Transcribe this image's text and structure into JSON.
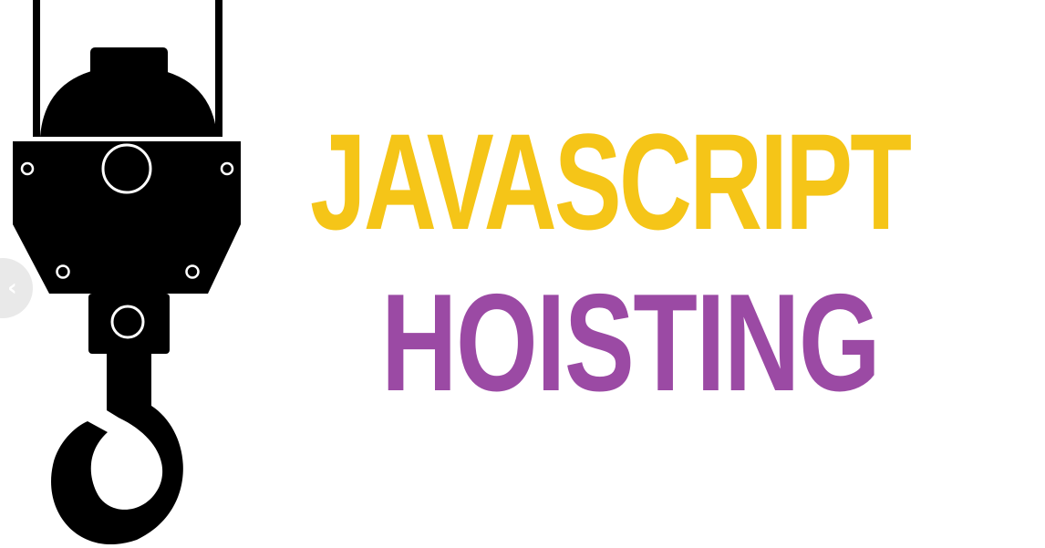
{
  "banner": {
    "title_line1": "JAVASCRIPT",
    "title_line2": "HOISTING"
  },
  "colors": {
    "line1": "#f5c518",
    "line2": "#9b4aa4",
    "hook": "#000000",
    "background": "#ffffff",
    "nav_button": "#e9e9e9"
  },
  "icons": {
    "hook": "crane-hook-icon",
    "previous": "chevron-left-icon"
  }
}
